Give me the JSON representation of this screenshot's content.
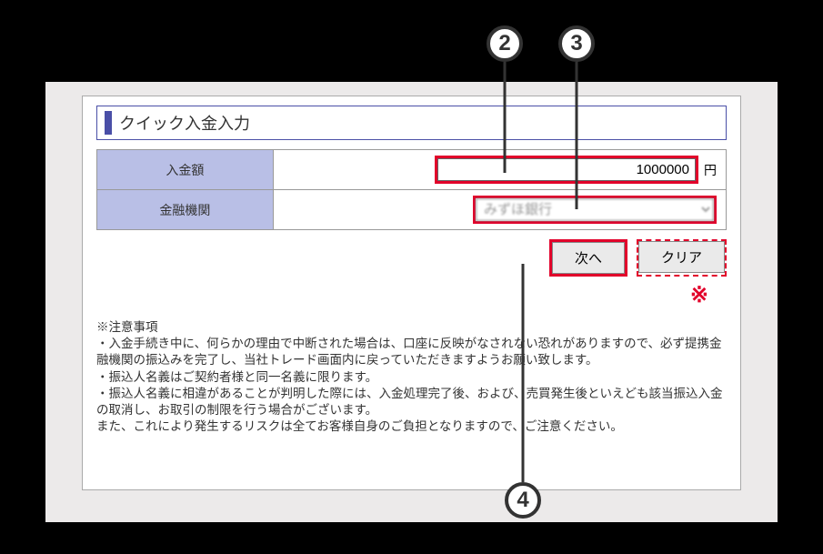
{
  "title": "クイック入金入力",
  "form": {
    "amount_label": "入金額",
    "amount_value": "1000000",
    "amount_unit": "円",
    "bank_label": "金融機関",
    "bank_selected": "みずほ銀行"
  },
  "buttons": {
    "next": "次へ",
    "clear": "クリア"
  },
  "star": "※",
  "notes": {
    "heading": "※注意事項",
    "line1": "・入金手続き中に、何らかの理由で中断された場合は、口座に反映がなされない恐れがありますので、必ず提携金融機関の振込みを完了し、当社トレード画面内に戻っていただきますようお願い致します。",
    "line2": "・振込人名義はご契約者様と同一名義に限ります。",
    "line3": "・振込人名義に相違があることが判明した際には、入金処理完了後、および、売買発生後といえども該当振込入金の取消し、お取引の制限を行う場合がございます。",
    "line4": "また、これにより発生するリスクは全てお客様自身のご負担となりますので、ご注意ください。"
  },
  "callouts": {
    "n2": "2",
    "n3": "3",
    "n4": "4"
  }
}
